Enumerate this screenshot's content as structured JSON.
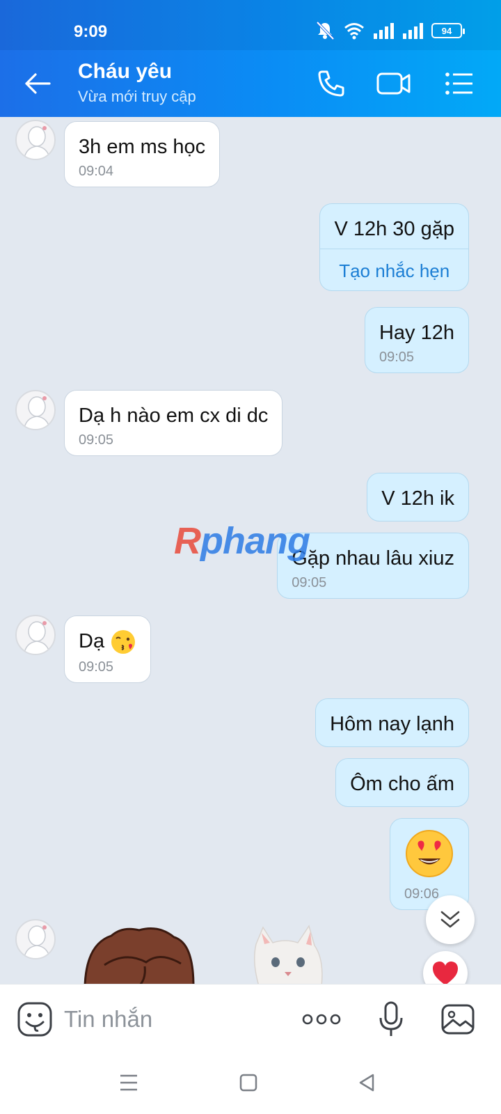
{
  "status_bar": {
    "time": "9:09",
    "battery": "94"
  },
  "header": {
    "title": "Cháu yêu",
    "subtitle": "Vừa mới truy cập",
    "icons": [
      "back-arrow-icon",
      "phone-icon",
      "video-call-icon",
      "menu-list-icon"
    ]
  },
  "messages": [
    {
      "dir": "in",
      "text": "3h em ms học",
      "time": "09:04"
    },
    {
      "dir": "out",
      "text": "V 12h 30 gặp",
      "action": "Tạo nhắc hẹn"
    },
    {
      "dir": "out",
      "text": "Hay 12h",
      "time": "09:05"
    },
    {
      "dir": "in",
      "text": "Dạ h nào em cx di dc",
      "time": "09:05"
    },
    {
      "dir": "out",
      "text": "V 12h ik"
    },
    {
      "dir": "out",
      "text": "Gặp nhau lâu xiuz",
      "time": "09:05"
    },
    {
      "dir": "in",
      "text": "Dạ",
      "emoji": "kissing-face-emoji",
      "time": "09:05"
    },
    {
      "dir": "out",
      "text": "Hôm nay lạnh"
    },
    {
      "dir": "out",
      "text": "Ôm cho ấm"
    },
    {
      "dir": "out",
      "emoji": "heart-eyes-emoji",
      "time": "09:06"
    }
  ],
  "watermark": {
    "r": "R",
    "rest": "phang"
  },
  "input": {
    "placeholder": "Tin nhắn"
  },
  "colors": {
    "header_start": "#1c6fe8",
    "header_end": "#02a9f7",
    "outgoing_bubble": "#d5f0ff",
    "incoming_bubble": "#ffffff",
    "link": "#1b7ed4"
  }
}
